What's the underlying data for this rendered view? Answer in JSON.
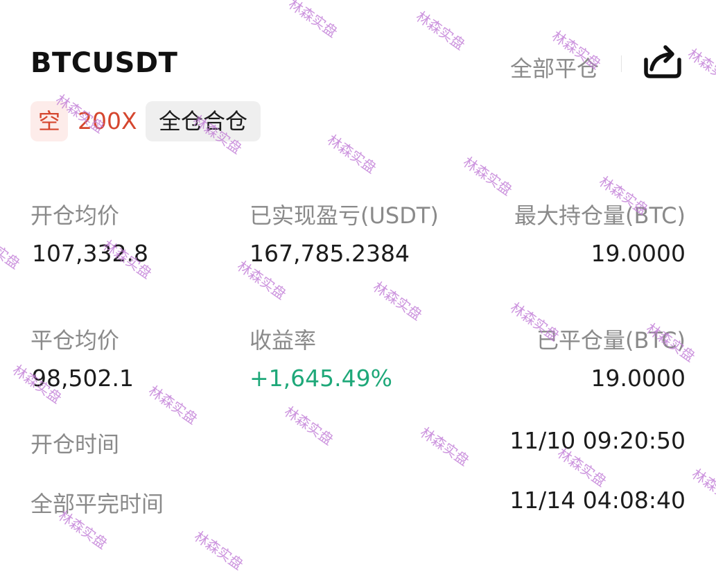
{
  "header": {
    "symbol": "BTCUSDT",
    "close_all_label": "全部平仓"
  },
  "tags": {
    "direction": "空",
    "leverage": "200X",
    "margin_mode": "全仓合仓"
  },
  "stats": {
    "open_avg_label": "开仓均价",
    "open_avg_value": "107,332.8",
    "realized_pnl_label": "已实现盈亏(USDT)",
    "realized_pnl_value": "167,785.2384",
    "max_position_label": "最大持仓量(BTC)",
    "max_position_value": "19.0000",
    "close_avg_label": "平仓均价",
    "close_avg_value": "98,502.1",
    "roi_label": "收益率",
    "roi_value": "+1,645.49%",
    "closed_qty_label": "已平仓量(BTC)",
    "closed_qty_value": "19.0000",
    "open_time_label": "开仓时间",
    "open_time_value": "11/10 09:20:50",
    "close_time_label": "全部平完时间",
    "close_time_value": "11/14 04:08:40"
  },
  "watermark": {
    "text": "林森实盘"
  },
  "colors": {
    "short": "#d5462e",
    "profit": "#1ea879",
    "label": "#8a8a8a"
  },
  "icons": {
    "share": "share-icon"
  }
}
